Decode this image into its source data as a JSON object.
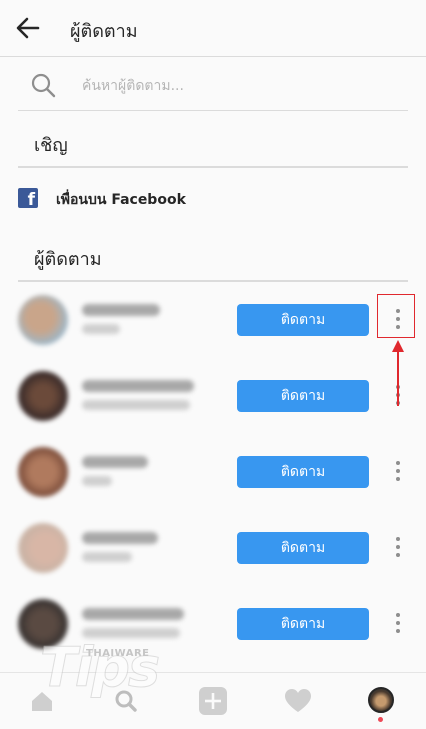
{
  "header": {
    "title": "ผู้ติดตาม"
  },
  "search": {
    "placeholder": "ค้นหาผู้ติดตาม..."
  },
  "invite": {
    "heading": "เชิญ",
    "facebook_label": "เพื่อนบน Facebook",
    "facebook_glyph": "f"
  },
  "followers": {
    "heading": "ผู้ติดตาม",
    "follow_label": "ติดตาม"
  },
  "watermark": {
    "brand": "THAIWARE",
    "text": "Tips"
  },
  "colors": {
    "accent": "#3897f0",
    "facebook": "#3b5998",
    "highlight": "#e0282e",
    "divider": "#dbdbdb"
  },
  "icons": [
    "back-arrow-icon",
    "search-icon",
    "facebook-icon",
    "more-vertical-icon",
    "home-icon",
    "add-icon",
    "heart-icon",
    "profile-avatar"
  ]
}
